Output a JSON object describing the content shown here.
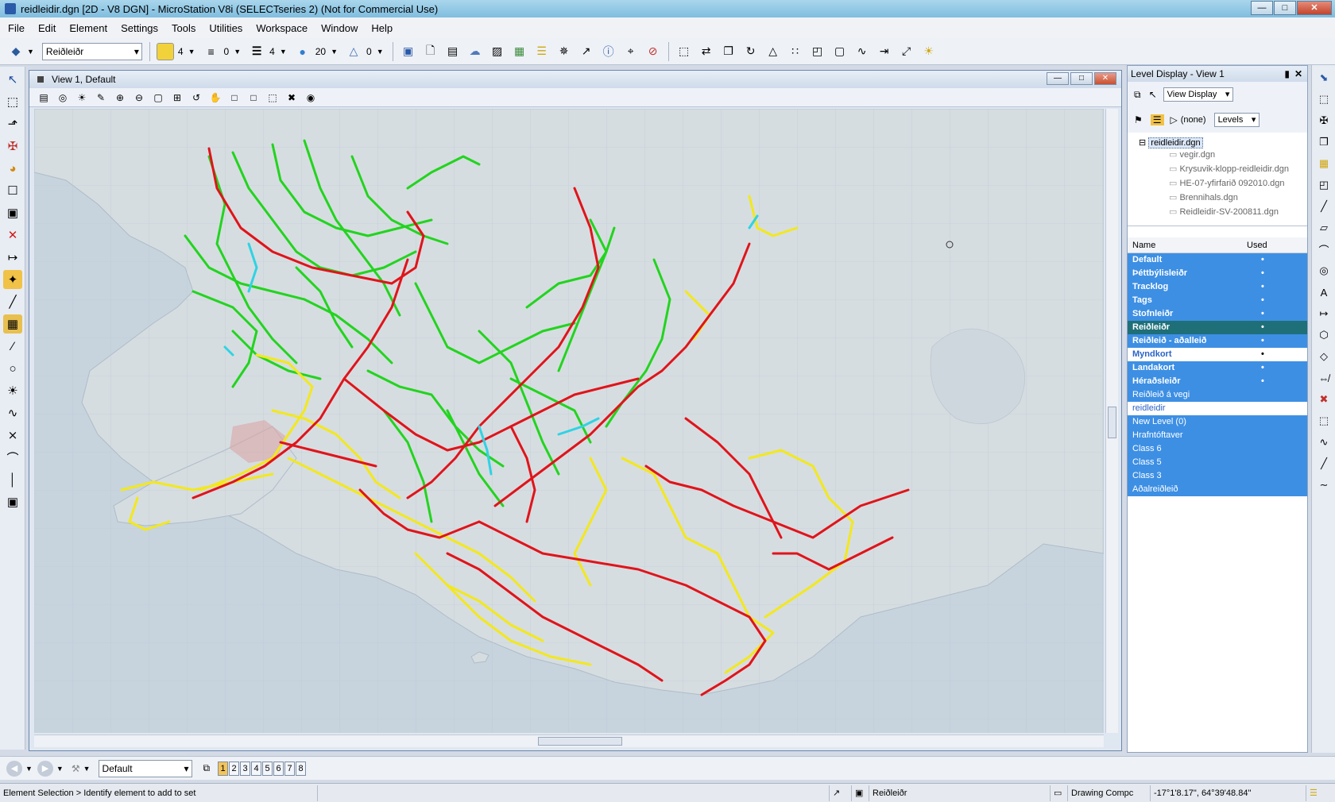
{
  "window": {
    "title": "reidleidir.dgn [2D - V8 DGN] - MicroStation V8i (SELECTseries 2) (Not for Commercial Use)"
  },
  "menu": [
    "File",
    "Edit",
    "Element",
    "Settings",
    "Tools",
    "Utilities",
    "Workspace",
    "Window",
    "Help"
  ],
  "toolbar": {
    "active_level": "Reiðleiðr",
    "color_value": "4",
    "style_value": "0",
    "weight_value": "4",
    "transparency_value": "20",
    "priority_value": "0"
  },
  "view": {
    "title": "View 1, Default"
  },
  "level_panel": {
    "title": "Level Display - View 1",
    "display_mode": "View Display",
    "filter": "(none)",
    "levels_combo": "Levels",
    "tree_root": "reidleidir.dgn",
    "tree_children": [
      "vegir.dgn",
      "Krysuvik-klopp-reidleidir.dgn",
      "HE-07-yfirfarið 092010.dgn",
      "Brennihals.dgn",
      "Reidleidir-SV-200811.dgn"
    ],
    "col_name": "Name",
    "col_used": "Used",
    "levels": [
      {
        "name": "Default",
        "used": "•",
        "style": "bold"
      },
      {
        "name": "Þéttbýlisleiðr",
        "used": "•",
        "style": "bold"
      },
      {
        "name": "Tracklog",
        "used": "•",
        "style": "bold"
      },
      {
        "name": "Tags",
        "used": "•",
        "style": "bold"
      },
      {
        "name": "Stofnleiðr",
        "used": "•",
        "style": "bold"
      },
      {
        "name": "Reiðleiðr",
        "used": "•",
        "style": "active"
      },
      {
        "name": "Reiðleið - aðalleið",
        "used": "•",
        "style": "bold"
      },
      {
        "name": "Myndkort",
        "used": "•",
        "style": "white"
      },
      {
        "name": "Landakort",
        "used": "•",
        "style": "bold"
      },
      {
        "name": "Héraðsleiðr",
        "used": "•",
        "style": "bold"
      },
      {
        "name": "Reiðleið á vegi",
        "used": "",
        "style": "normal"
      },
      {
        "name": "reidleidir",
        "used": "",
        "style": "white"
      },
      {
        "name": "New Level (0)",
        "used": "",
        "style": "normal"
      },
      {
        "name": "Hrafntóftaver",
        "used": "",
        "style": "normal"
      },
      {
        "name": "Class 6",
        "used": "",
        "style": "normal"
      },
      {
        "name": "Class 5",
        "used": "",
        "style": "normal"
      },
      {
        "name": "Class 3",
        "used": "",
        "style": "normal"
      },
      {
        "name": "Aðalreiðleið",
        "used": "",
        "style": "normal"
      }
    ]
  },
  "view_controls": {
    "view_group": "Default",
    "view_numbers": [
      "1",
      "2",
      "3",
      "4",
      "5",
      "6",
      "7",
      "8"
    ]
  },
  "status": {
    "prompt": "Element Selection > Identify element to add to set",
    "active_level": "Reiðleiðr",
    "drawing": "Drawing Compc",
    "coords": "-17°1'8.17\", 64°39'48.84\""
  },
  "colors": {
    "route_green": "#22d41e",
    "route_red": "#e0141a",
    "route_yellow": "#f3e81c",
    "route_cyan": "#2fd3e3",
    "sea": "#c5d3de",
    "land": "#d3dbe0",
    "level_selected": "#3d8fe4",
    "level_active": "#1f6f78"
  }
}
